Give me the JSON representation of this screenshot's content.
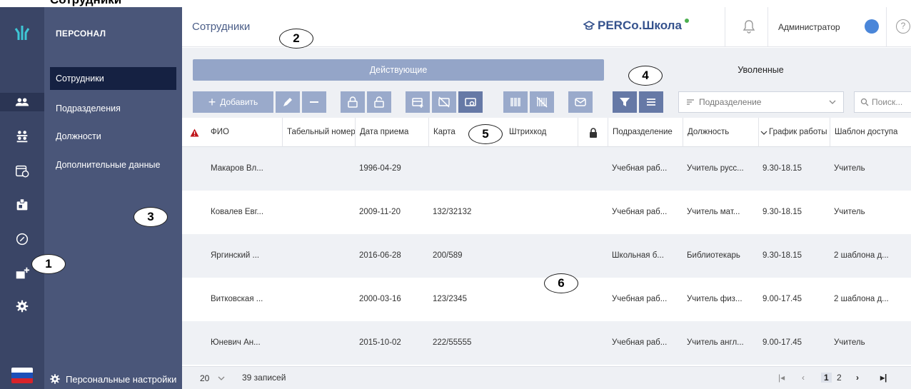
{
  "top_fragment": "Сотрудники",
  "app": {
    "page_title": "Сотрудники",
    "brand": "PERCo.Школа",
    "user_name": "Администратор",
    "help_label": "?"
  },
  "sidebar": {
    "section_title": "ПЕРСОНАЛ",
    "items": [
      {
        "label": "Сотрудники"
      },
      {
        "label": "Подразделения"
      },
      {
        "label": "Должности"
      },
      {
        "label": "Дополнительные данные"
      }
    ],
    "settings_label": "Персональные настройки"
  },
  "rail": {
    "icons": [
      "people-icon",
      "groups-icon",
      "calendar-clock-icon",
      "id-card-icon",
      "link-icon",
      "add-card-icon",
      "gear-icon"
    ],
    "active_index": 0
  },
  "tabs": [
    {
      "label": "Действующие",
      "active": true
    },
    {
      "label": "Уволенные",
      "active": false
    }
  ],
  "toolbar": {
    "add_label": "Добавить",
    "filter_placeholder": "Подразделение",
    "search_placeholder": "Поиск..."
  },
  "columns": [
    "ФИО",
    "Табельный номер",
    "Дата приема",
    "Карта",
    "Штрихкод",
    "Подразделение",
    "Должность",
    "График работы",
    "Шаблон доступа"
  ],
  "rows": [
    {
      "name": "Макаров Вл...",
      "hired": "1996-04-29",
      "card": "",
      "dept": "Учебная раб...",
      "position": "Учитель русс...",
      "schedule": "9.30-18.15",
      "template": "Учитель"
    },
    {
      "name": "Ковалев Евг...",
      "hired": "2009-11-20",
      "card": "132/32132",
      "dept": "Учебная раб...",
      "position": "Учитель мат...",
      "schedule": "9.30-18.15",
      "template": "Учитель"
    },
    {
      "name": "Яргинский ...",
      "hired": "2016-06-28",
      "card": "200/589",
      "dept": "Школьная б...",
      "position": "Библиотекарь",
      "schedule": "9.30-18.15",
      "template": "2 шаблона д..."
    },
    {
      "name": "Витковская ...",
      "hired": "2000-03-16",
      "card": "123/2345",
      "dept": "Учебная раб...",
      "position": "Учитель физ...",
      "schedule": "9.00-17.45",
      "template": "2 шаблона д..."
    },
    {
      "name": "Юневич Ан...",
      "hired": "2015-10-02",
      "card": "222/55555",
      "dept": "Учебная раб...",
      "position": "Учитель англ...",
      "schedule": "9.00-17.45",
      "template": "Учитель"
    }
  ],
  "footer": {
    "page_size": "20",
    "records": "39 записей",
    "pages": [
      "1",
      "2"
    ],
    "current_page": "1"
  },
  "callouts": [
    "1",
    "2",
    "3",
    "4",
    "5",
    "6"
  ],
  "colors": {
    "rail": "#3a4566",
    "sidebar": "#4a5679",
    "active_item": "#152142",
    "tab_active": "#94a5c8",
    "button": "#9aaacb",
    "alert": "#c0161c",
    "brand": "#35528d"
  }
}
